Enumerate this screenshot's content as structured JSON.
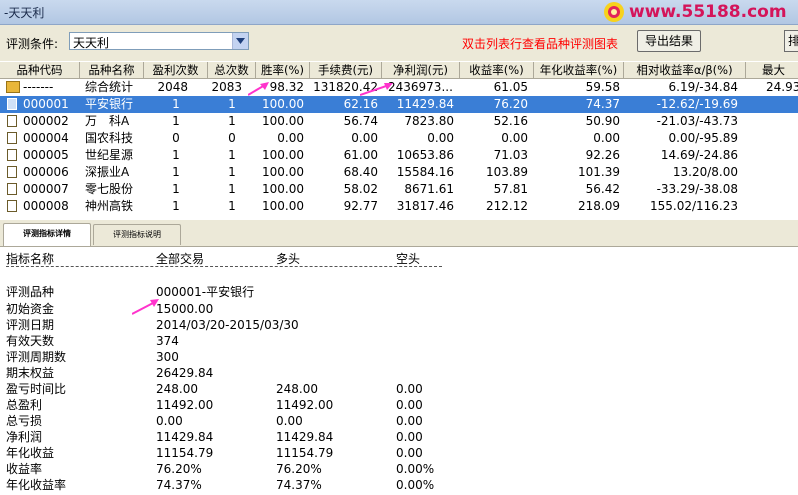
{
  "window": {
    "title": "-天天利"
  },
  "watermark": {
    "text": "www.55188.com"
  },
  "condition": {
    "label": "评测条件:",
    "value": "天天利",
    "hint": "双击列表行查看品种评测图表",
    "export_label": "导出结果",
    "extra_label": "排"
  },
  "table": {
    "headers": [
      "品种代码",
      "品种名称",
      "盈利次数",
      "总次数",
      "胜率(%)",
      "手续费(元)",
      "净利润(元)",
      "收益率(%)",
      "年化收益率(%)",
      "相对收益率α/β(%)",
      "最大"
    ],
    "rows": [
      {
        "code": "-------",
        "name": "综合统计",
        "wins": "2048",
        "total": "2083",
        "winrate": "98.32",
        "fee": "131820.42",
        "profit": "2436973...",
        "ret": "61.05",
        "annual": "59.58",
        "rel": "6.19/-34.84",
        "max": "24.93"
      },
      {
        "code": "000001",
        "name": "平安银行",
        "wins": "1",
        "total": "1",
        "winrate": "100.00",
        "fee": "62.16",
        "profit": "11429.84",
        "ret": "76.20",
        "annual": "74.37",
        "rel": "-12.62/-19.69",
        "max": ""
      },
      {
        "code": "000002",
        "name": "万　科A",
        "wins": "1",
        "total": "1",
        "winrate": "100.00",
        "fee": "56.74",
        "profit": "7823.80",
        "ret": "52.16",
        "annual": "50.90",
        "rel": "-21.03/-43.73",
        "max": ""
      },
      {
        "code": "000004",
        "name": "国农科技",
        "wins": "0",
        "total": "0",
        "winrate": "0.00",
        "fee": "0.00",
        "profit": "0.00",
        "ret": "0.00",
        "annual": "0.00",
        "rel": "0.00/-95.89",
        "max": ""
      },
      {
        "code": "000005",
        "name": "世纪星源",
        "wins": "1",
        "total": "1",
        "winrate": "100.00",
        "fee": "61.00",
        "profit": "10653.86",
        "ret": "71.03",
        "annual": "92.26",
        "rel": "14.69/-24.86",
        "max": ""
      },
      {
        "code": "000006",
        "name": "深振业A",
        "wins": "1",
        "total": "1",
        "winrate": "100.00",
        "fee": "68.40",
        "profit": "15584.16",
        "ret": "103.89",
        "annual": "101.39",
        "rel": "13.20/8.00",
        "max": ""
      },
      {
        "code": "000007",
        "name": "零七股份",
        "wins": "1",
        "total": "1",
        "winrate": "100.00",
        "fee": "58.02",
        "profit": "8671.61",
        "ret": "57.81",
        "annual": "56.42",
        "rel": "-33.29/-38.08",
        "max": ""
      },
      {
        "code": "000008",
        "name": "神州高铁",
        "wins": "1",
        "total": "1",
        "winrate": "100.00",
        "fee": "92.77",
        "profit": "31817.46",
        "ret": "212.12",
        "annual": "218.09",
        "rel": "155.02/116.23",
        "max": ""
      }
    ]
  },
  "tabs": [
    {
      "label": "评测指标详情"
    },
    {
      "label": "评测指标说明"
    }
  ],
  "detail": {
    "headers": [
      "指标名称",
      "全部交易",
      "多头",
      "空头"
    ],
    "rows": [
      {
        "name": "评测品种",
        "all": "000001-平安银行",
        "long": "",
        "short": ""
      },
      {
        "name": "初始资金",
        "all": "15000.00",
        "long": "",
        "short": ""
      },
      {
        "name": "评测日期",
        "all": "2014/03/20-2015/03/30",
        "long": "",
        "short": ""
      },
      {
        "name": "有效天数",
        "all": "374",
        "long": "",
        "short": ""
      },
      {
        "name": "评测周期数",
        "all": "300",
        "long": "",
        "short": ""
      },
      {
        "name": "期末权益",
        "all": "26429.84",
        "long": "",
        "short": ""
      },
      {
        "name": "盈亏时间比",
        "all": "248.00",
        "long": "248.00",
        "short": "0.00"
      },
      {
        "name": "总盈利",
        "all": "11492.00",
        "long": "11492.00",
        "short": "0.00"
      },
      {
        "name": "总亏损",
        "all": "0.00",
        "long": "0.00",
        "short": "0.00"
      },
      {
        "name": "净利润",
        "all": "11429.84",
        "long": "11429.84",
        "short": "0.00"
      },
      {
        "name": "年化收益",
        "all": "11154.79",
        "long": "11154.79",
        "short": "0.00"
      },
      {
        "name": "收益率",
        "all": "76.20%",
        "long": "76.20%",
        "short": "0.00%"
      },
      {
        "name": "年化收益率",
        "all": "74.37%",
        "long": "74.37%",
        "short": "0.00%"
      }
    ]
  },
  "colors": {
    "selection": "#3a7ed6",
    "hint": "#ff0000",
    "watermark": "#d4145a",
    "arrow": "#ff33cc"
  }
}
